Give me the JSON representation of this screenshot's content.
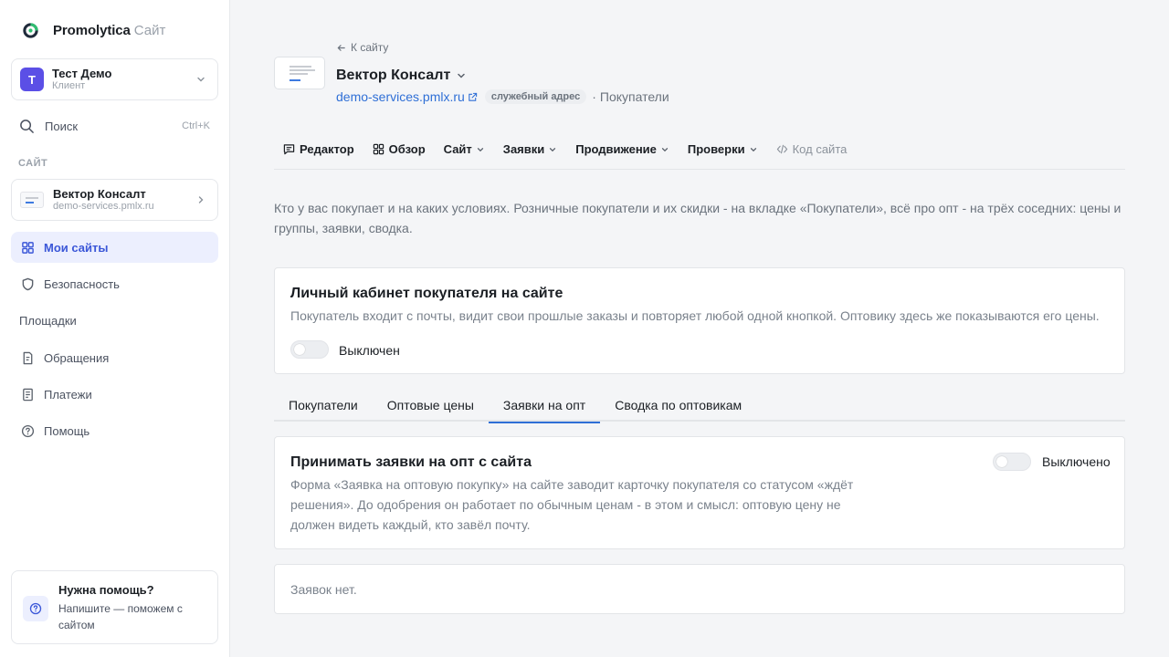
{
  "brand": {
    "name": "Promolytica",
    "sub": "Сайт"
  },
  "account": {
    "initial": "Т",
    "name": "Тест Демо",
    "role": "Клиент"
  },
  "search": {
    "label": "Поиск",
    "shortcut": "Ctrl+K"
  },
  "sidebar": {
    "section_label": "САЙТ",
    "site": {
      "name": "Вектор Консалт",
      "domain": "demo-services.pmlx.ru"
    },
    "items": [
      {
        "label": "Мои сайты",
        "icon": "grid-icon",
        "active": true
      },
      {
        "label": "Безопасность",
        "icon": "shield-icon"
      },
      {
        "label": "Площадки",
        "icon": ""
      },
      {
        "label": "Обращения",
        "icon": "document-icon"
      },
      {
        "label": "Платежи",
        "icon": "receipt-icon"
      },
      {
        "label": "Помощь",
        "icon": "help-icon"
      }
    ],
    "help": {
      "title": "Нужна помощь?",
      "text": "Напишите — поможем с сайтом"
    }
  },
  "header": {
    "back": "К сайту",
    "title": "Вектор Консалт",
    "domain": "demo-services.pmlx.ru",
    "badge": "служебный адрес",
    "separator": "·",
    "page": "Покупатели"
  },
  "menu": [
    {
      "label": "Редактор",
      "icon": "chat-icon"
    },
    {
      "label": "Обзор",
      "icon": "grid-icon"
    },
    {
      "label": "Сайт",
      "dropdown": true
    },
    {
      "label": "Заявки",
      "dropdown": true
    },
    {
      "label": "Продвижение",
      "dropdown": true
    },
    {
      "label": "Проверки",
      "dropdown": true
    },
    {
      "label": "Код сайта",
      "icon": "code-icon",
      "muted": true
    }
  ],
  "intro": "Кто у вас покупает и на каких условиях. Розничные покупатели и их скидки - на вкладке «Покупатели», всё про опт - на трёх соседних: цены и группы, заявки, сводка.",
  "cabinet": {
    "title": "Личный кабинет покупателя на сайте",
    "desc": "Покупатель входит с почты, видит свои прошлые заказы и повторяет любой одной кнопкой. Оптовику здесь же показываются его цены.",
    "toggle_label": "Выключен"
  },
  "tabs": [
    {
      "label": "Покупатели"
    },
    {
      "label": "Оптовые цены"
    },
    {
      "label": "Заявки на опт",
      "active": true
    },
    {
      "label": "Сводка по оптовикам"
    }
  ],
  "wholesale": {
    "title": "Принимать заявки на опт с сайта",
    "desc": "Форма «Заявка на оптовую покупку» на сайте заводит карточку покупателя со статусом «ждёт решения». До одобрения он работает по обычным ценам - в этом и смысл: оптовую цену не должен видеть каждый, кто завёл почту.",
    "toggle_label": "Выключено"
  },
  "requests": {
    "empty": "Заявок нет."
  },
  "colors": {
    "accent": "#3b57d8",
    "link": "#2f6fd6",
    "avatar": "#5b4fe6"
  }
}
